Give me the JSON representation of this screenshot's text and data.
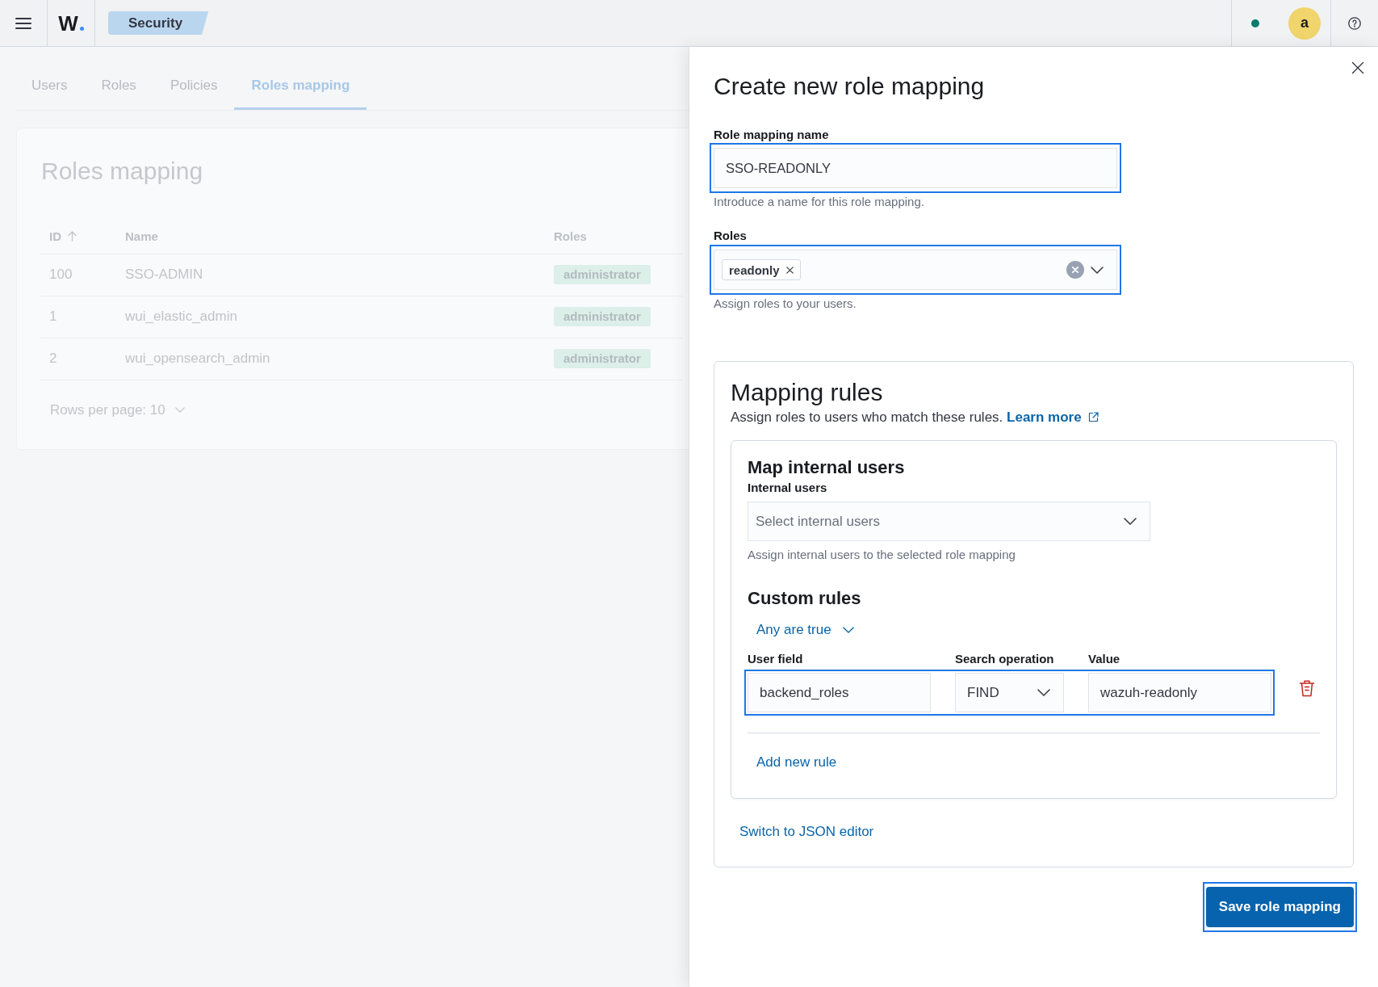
{
  "header": {
    "logo": "W",
    "breadcrumb": "Security",
    "avatar": "a"
  },
  "tabs": [
    {
      "label": "Users",
      "selected": false
    },
    {
      "label": "Roles",
      "selected": false
    },
    {
      "label": "Policies",
      "selected": false
    },
    {
      "label": "Roles mapping",
      "selected": true
    }
  ],
  "roles_mapping": {
    "title": "Roles mapping",
    "table": {
      "columns": [
        {
          "label": "ID",
          "sorted": true
        },
        {
          "label": "Name",
          "sorted": false
        },
        {
          "label": "Roles",
          "sorted": false
        }
      ],
      "rows": [
        {
          "id": "100",
          "name": "SSO-ADMIN",
          "roles": [
            "administrator"
          ]
        },
        {
          "id": "1",
          "name": "wui_elastic_admin",
          "roles": [
            "administrator"
          ]
        },
        {
          "id": "2",
          "name": "wui_opensearch_admin",
          "roles": [
            "administrator"
          ]
        }
      ]
    },
    "pagination": "Rows per page: 10"
  },
  "flyout": {
    "title": "Create new role mapping",
    "name_field": {
      "label": "Role mapping name",
      "value": "SSO-READONLY",
      "help": "Introduce a name for this role mapping.",
      "highlighted": true
    },
    "roles_field": {
      "label": "Roles",
      "selected_roles": [
        "readonly"
      ],
      "help": "Assign roles to your users.",
      "highlighted": true
    },
    "mapping_rules": {
      "title": "Mapping rules",
      "description": "Assign roles to users who match these rules.",
      "learn_more": "Learn more",
      "internal_users": {
        "heading": "Map internal users",
        "label": "Internal users",
        "placeholder": "Select internal users",
        "help": "Assign internal users to the selected role mapping"
      },
      "custom_rules": {
        "heading": "Custom rules",
        "operator": "Any are true",
        "columns": [
          "User field",
          "Search operation",
          "Value"
        ],
        "rules": [
          {
            "user_field": "backend_roles",
            "operation": "FIND",
            "value": "wazuh-readonly",
            "highlighted": true
          }
        ],
        "add_rule": "Add new rule"
      },
      "json_editor_link": "Switch to JSON editor"
    },
    "save_button": {
      "label": "Save role mapping",
      "highlighted": true
    }
  }
}
